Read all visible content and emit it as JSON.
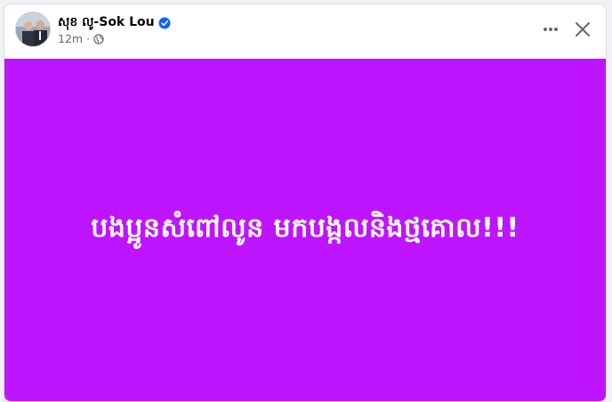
{
  "author": {
    "name": "សុខ លូ-Sok Lou",
    "verified_icon": "verified-badge-icon"
  },
  "meta": {
    "timestamp": "12m",
    "separator": "·",
    "audience_icon": "globe-icon"
  },
  "actions": {
    "more_icon": "more-options-icon",
    "close_icon": "close-icon"
  },
  "post": {
    "text": "បងប្អូនសំពៅលូន មកបង្កលនិងថ្មគោល!!!",
    "background_color": "#bf14ff",
    "text_color": "#ffffff"
  },
  "colors": {
    "verified": "#0866ff",
    "meta_text": "#65676b",
    "author_text": "#050505"
  }
}
